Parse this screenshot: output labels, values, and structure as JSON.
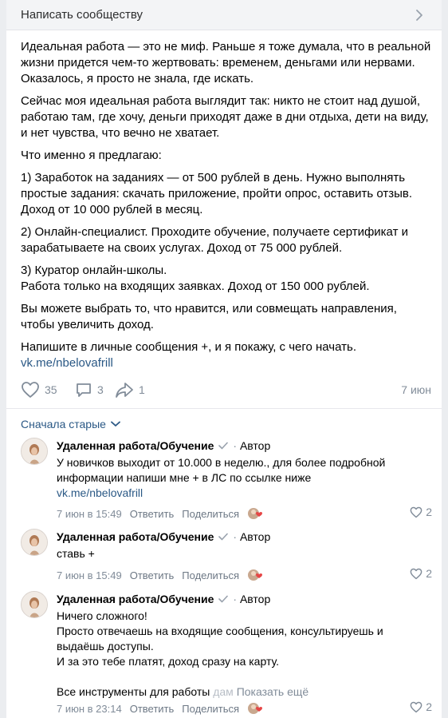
{
  "topbar": {
    "title": "Написать сообществу"
  },
  "post": {
    "paragraphs": [
      "Идеальная работа — это не миф. Раньше я тоже думала, что в реальной жизни придется чем-то жертвовать: временем, деньгами или нервами. Оказалось, я просто не знала, где искать.",
      "Сейчас моя идеальная работа выглядит так: никто не стоит над душой, работаю там, где хочу, деньги приходят даже в дни отдыха, дети на виду, и нет чувства, что вечно не хватает.",
      "Что именно я предлагаю:",
      "1) Заработок на заданиях — от 500 рублей в день. Нужно выполнять простые задания: скачать приложение, пройти опрос, оставить отзыв. Доход от 10 000 рублей в месяц.",
      "2) Онлайн-специалист. Проходите обучение, получаете сертификат и зарабатываете на своих услугах. Доход от 75 000 рублей.",
      "3) Куратор онлайн-школы.\nРабота только на входящих заявках. Доход от 150 000 рублей.",
      "Вы можете выбрать то, что нравится, или совмещать направления, чтобы увеличить доход.",
      "Напишите в личные сообщения +, и я покажу, с чего начать."
    ],
    "link": "vk.me/nbelovafrill",
    "likes": "35",
    "comments": "3",
    "shares": "1",
    "date": "7 июн"
  },
  "sort_label": "Сначала старые",
  "comments": [
    {
      "author": "Удаленная работа/Обучение",
      "tag": "Автор",
      "text": "У новичков выходит от 10.000 в неделю., для более подробной информации напиши мне + в ЛС по ссылке ниже",
      "link": "vk.me/nbelovafrill",
      "time": "7 июн в 15:49",
      "reply": "Ответить",
      "share": "Поделиться",
      "likes": "2"
    },
    {
      "author": "Удаленная работа/Обучение",
      "tag": "Автор",
      "text": "ставь +",
      "time": "7 июн в 15:49",
      "reply": "Ответить",
      "share": "Поделиться",
      "likes": "2"
    },
    {
      "author": "Удаленная работа/Обучение",
      "tag": "Автор",
      "text": "Ничего сложного!\nПросто отвечаешь на входящие сообщения, консультируешь и выдаёшь доступы.\nИ за это тебе платят, доход сразу на карту.",
      "truncated": "Все инструменты для работы ",
      "truncated_fade": "дам",
      "show_more": "Показать ещё",
      "time": "7 июн в 23:14",
      "reply": "Ответить",
      "share": "Поделиться",
      "likes": "2"
    }
  ],
  "colors": {
    "link": "#2a5885",
    "muted": "#818c99",
    "like_red": "#e64646"
  }
}
